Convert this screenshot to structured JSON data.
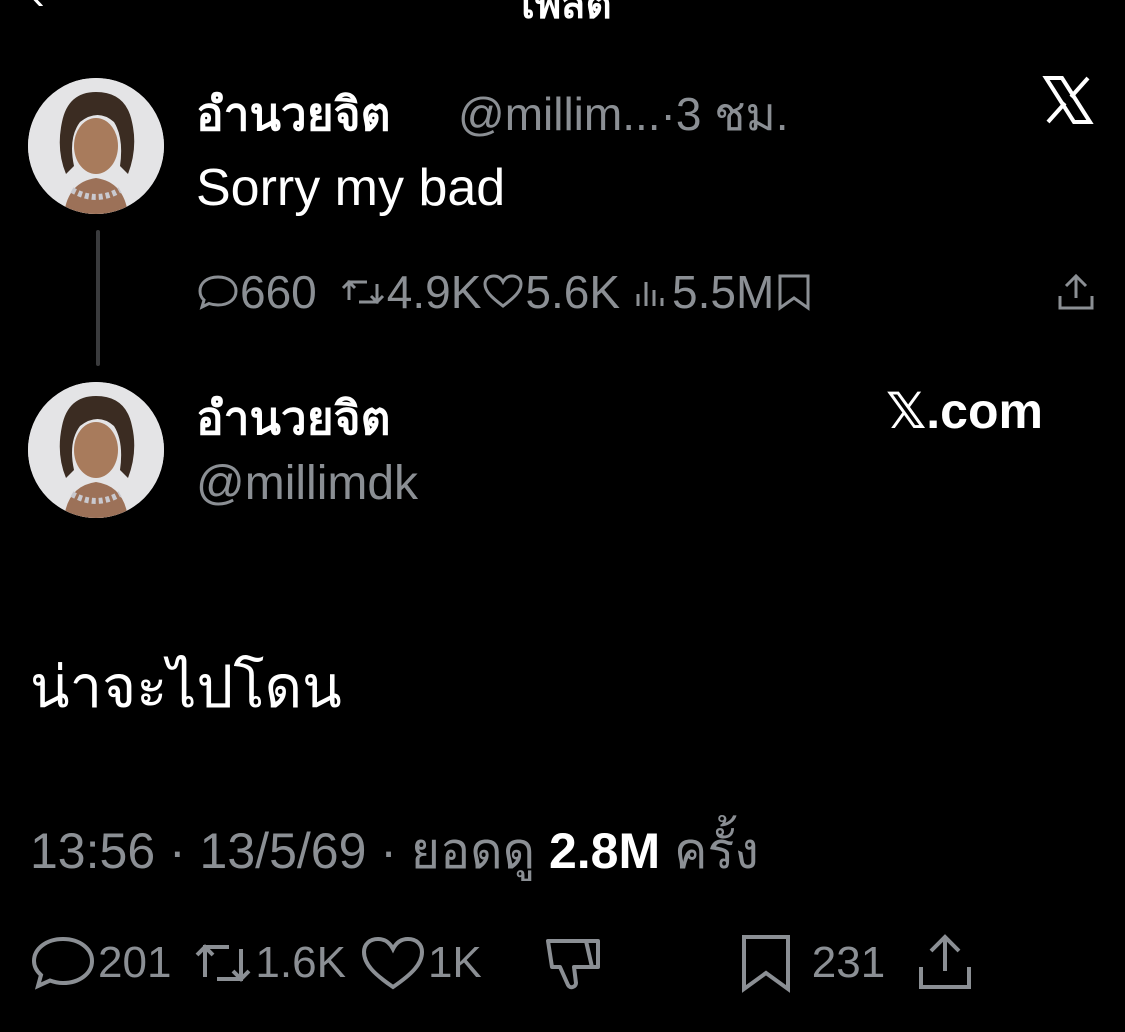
{
  "header": {
    "title": "โพสต์"
  },
  "quoted_post": {
    "display_name": "อำนวยจิต",
    "handle_time": "@millim...·3 ชม.",
    "text": "Sorry my bad",
    "stats": {
      "replies": "660",
      "reposts": "4.9K",
      "likes": "5.6K",
      "views": "5.5M"
    }
  },
  "main_post": {
    "display_name": "อำนวยจิต",
    "handle": "@millimdk",
    "badge": "𝕏.com",
    "text": "น่าจะไปโดน",
    "meta": {
      "time_date": "13:56 · 13/5/69 · ยอดดู ",
      "views": "2.8M",
      "views_unit": " ครั้ง"
    },
    "stats": {
      "replies": "201",
      "reposts": "1.6K",
      "likes": "1K",
      "bookmarks": "231"
    }
  },
  "colors": {
    "background": "#000000",
    "text_primary": "#ffffff",
    "text_secondary": "#8b8f94"
  }
}
